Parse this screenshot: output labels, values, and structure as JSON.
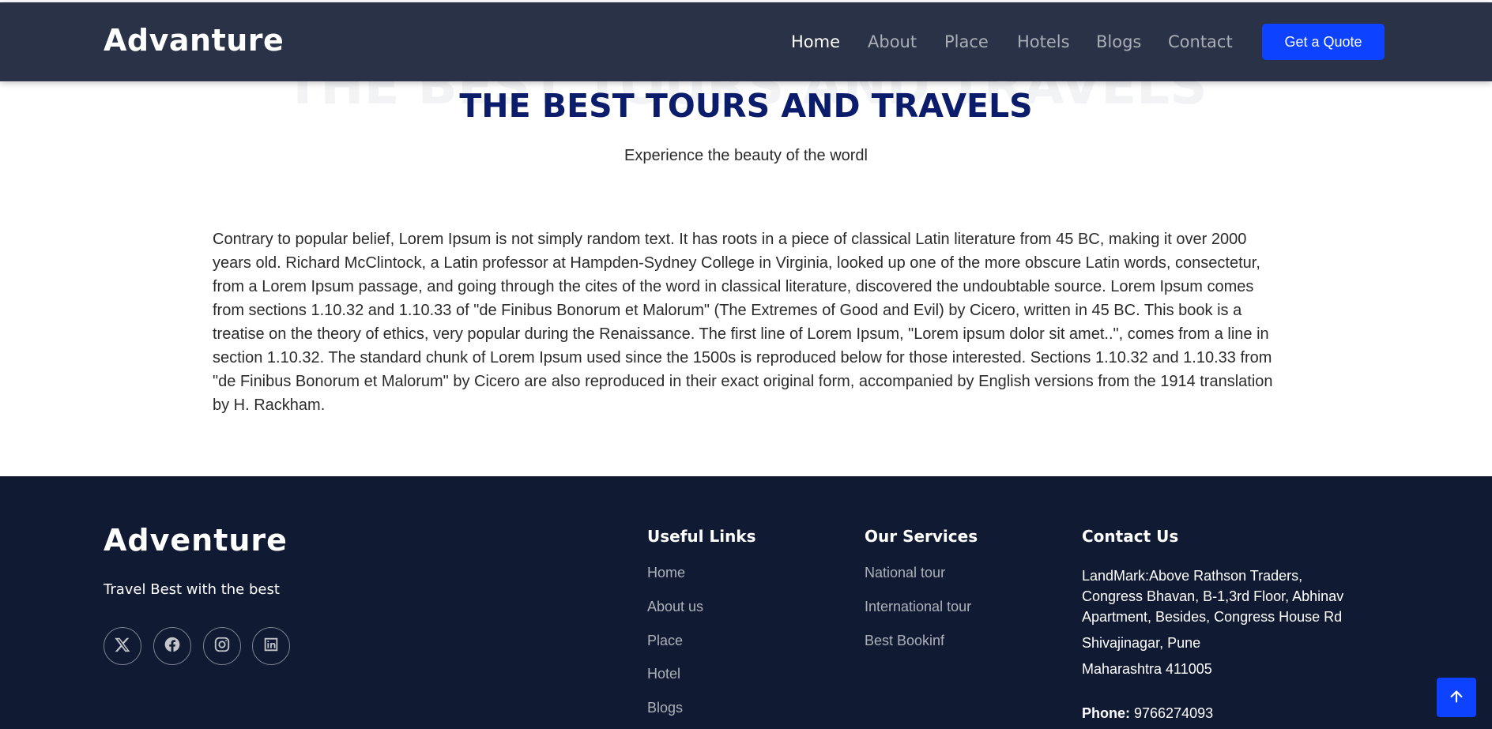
{
  "header": {
    "brand": "Advanture",
    "nav": [
      {
        "label": "Home",
        "active": true
      },
      {
        "label": "About",
        "active": false
      },
      {
        "label": "Place",
        "active": false
      },
      {
        "label": "Hotels",
        "active": false
      },
      {
        "label": "Blogs",
        "active": false
      },
      {
        "label": "Contact",
        "active": false
      }
    ],
    "cta_label": "Get a Quote"
  },
  "hero": {
    "background_title": "THE BEST TOURS AND TRAVELS",
    "title": "THE BEST TOURS AND TRAVELS",
    "subtitle": "Experience the beauty of the wordl"
  },
  "intro": {
    "paragraph": "Contrary to popular belief, Lorem Ipsum is not simply random text. It has roots in a piece of classical Latin literature from 45 BC, making it over 2000 years old. Richard McClintock, a Latin professor at Hampden-Sydney College in Virginia, looked up one of the more obscure Latin words, consectetur, from a Lorem Ipsum passage, and going through the cites of the word in classical literature, discovered the undoubtable source. Lorem Ipsum comes from sections 1.10.32 and 1.10.33 of \"de Finibus Bonorum et Malorum\" (The Extremes of Good and Evil) by Cicero, written in 45 BC. This book is a treatise on the theory of ethics, very popular during the Renaissance. The first line of Lorem Ipsum, \"Lorem ipsum dolor sit amet..\", comes from a line in section 1.10.32. The standard chunk of Lorem Ipsum used since the 1500s is reproduced below for those interested. Sections 1.10.32 and 1.10.33 from \"de Finibus Bonorum et Malorum\" by Cicero are also reproduced in their exact original form, accompanied by English versions from the 1914 translation by H. Rackham."
  },
  "footer": {
    "brand": "Adventure",
    "tagline": "Travel Best with the best",
    "social": [
      "x-icon",
      "facebook-icon",
      "instagram-icon",
      "linkedin-icon"
    ],
    "useful_links": {
      "heading": "Useful Links",
      "items": [
        "Home",
        "About us",
        "Place",
        "Hotel",
        "Blogs"
      ]
    },
    "services": {
      "heading": "Our Services",
      "items": [
        "National tour",
        "International tour",
        "Best Bookinf"
      ]
    },
    "contact": {
      "heading": "Contact Us",
      "address_line": "LandMark:Above Rathson Traders, Congress Bhavan, B-1,3rd Floor, Abhinav Apartment, Besides, Congress House Rd",
      "city": "Shivajinagar, Pune",
      "state": "Maharashtra 411005",
      "phone_label": "Phone:",
      "phone": "9766274093"
    }
  },
  "colors": {
    "header_bg": "#293247",
    "footer_bg": "#101b33",
    "accent": "#0d42ff",
    "title": "#0b1c6b"
  }
}
